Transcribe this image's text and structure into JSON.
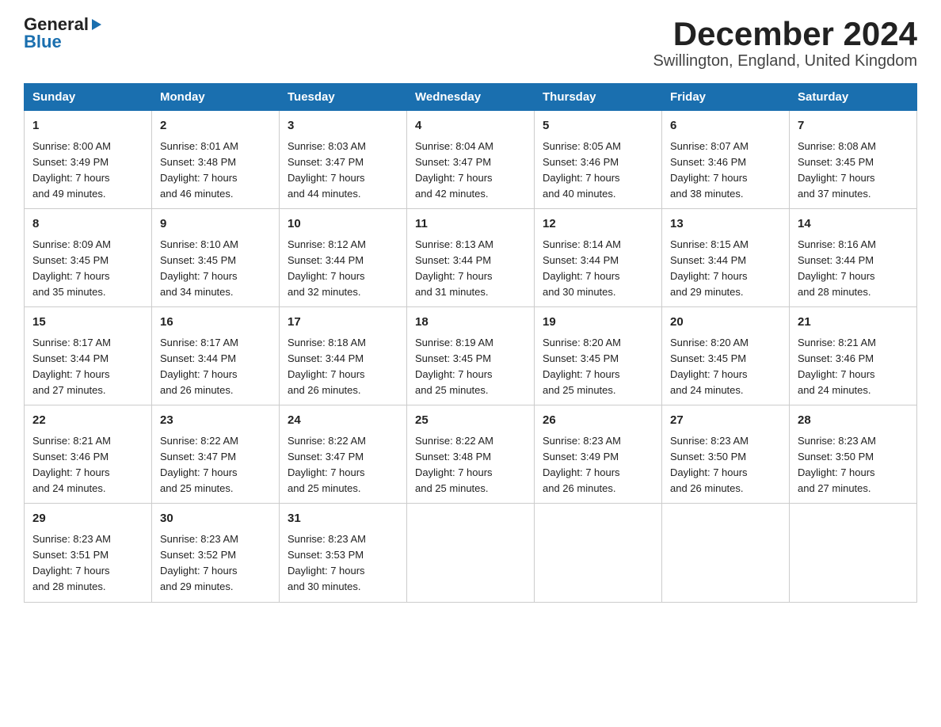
{
  "header": {
    "title": "December 2024",
    "subtitle": "Swillington, England, United Kingdom",
    "logo_general": "General",
    "logo_blue": "Blue"
  },
  "days_of_week": [
    "Sunday",
    "Monday",
    "Tuesday",
    "Wednesday",
    "Thursday",
    "Friday",
    "Saturday"
  ],
  "weeks": [
    [
      {
        "day": "1",
        "sunrise": "8:00 AM",
        "sunset": "3:49 PM",
        "daylight": "7 hours and 49 minutes."
      },
      {
        "day": "2",
        "sunrise": "8:01 AM",
        "sunset": "3:48 PM",
        "daylight": "7 hours and 46 minutes."
      },
      {
        "day": "3",
        "sunrise": "8:03 AM",
        "sunset": "3:47 PM",
        "daylight": "7 hours and 44 minutes."
      },
      {
        "day": "4",
        "sunrise": "8:04 AM",
        "sunset": "3:47 PM",
        "daylight": "7 hours and 42 minutes."
      },
      {
        "day": "5",
        "sunrise": "8:05 AM",
        "sunset": "3:46 PM",
        "daylight": "7 hours and 40 minutes."
      },
      {
        "day": "6",
        "sunrise": "8:07 AM",
        "sunset": "3:46 PM",
        "daylight": "7 hours and 38 minutes."
      },
      {
        "day": "7",
        "sunrise": "8:08 AM",
        "sunset": "3:45 PM",
        "daylight": "7 hours and 37 minutes."
      }
    ],
    [
      {
        "day": "8",
        "sunrise": "8:09 AM",
        "sunset": "3:45 PM",
        "daylight": "7 hours and 35 minutes."
      },
      {
        "day": "9",
        "sunrise": "8:10 AM",
        "sunset": "3:45 PM",
        "daylight": "7 hours and 34 minutes."
      },
      {
        "day": "10",
        "sunrise": "8:12 AM",
        "sunset": "3:44 PM",
        "daylight": "7 hours and 32 minutes."
      },
      {
        "day": "11",
        "sunrise": "8:13 AM",
        "sunset": "3:44 PM",
        "daylight": "7 hours and 31 minutes."
      },
      {
        "day": "12",
        "sunrise": "8:14 AM",
        "sunset": "3:44 PM",
        "daylight": "7 hours and 30 minutes."
      },
      {
        "day": "13",
        "sunrise": "8:15 AM",
        "sunset": "3:44 PM",
        "daylight": "7 hours and 29 minutes."
      },
      {
        "day": "14",
        "sunrise": "8:16 AM",
        "sunset": "3:44 PM",
        "daylight": "7 hours and 28 minutes."
      }
    ],
    [
      {
        "day": "15",
        "sunrise": "8:17 AM",
        "sunset": "3:44 PM",
        "daylight": "7 hours and 27 minutes."
      },
      {
        "day": "16",
        "sunrise": "8:17 AM",
        "sunset": "3:44 PM",
        "daylight": "7 hours and 26 minutes."
      },
      {
        "day": "17",
        "sunrise": "8:18 AM",
        "sunset": "3:44 PM",
        "daylight": "7 hours and 26 minutes."
      },
      {
        "day": "18",
        "sunrise": "8:19 AM",
        "sunset": "3:45 PM",
        "daylight": "7 hours and 25 minutes."
      },
      {
        "day": "19",
        "sunrise": "8:20 AM",
        "sunset": "3:45 PM",
        "daylight": "7 hours and 25 minutes."
      },
      {
        "day": "20",
        "sunrise": "8:20 AM",
        "sunset": "3:45 PM",
        "daylight": "7 hours and 24 minutes."
      },
      {
        "day": "21",
        "sunrise": "8:21 AM",
        "sunset": "3:46 PM",
        "daylight": "7 hours and 24 minutes."
      }
    ],
    [
      {
        "day": "22",
        "sunrise": "8:21 AM",
        "sunset": "3:46 PM",
        "daylight": "7 hours and 24 minutes."
      },
      {
        "day": "23",
        "sunrise": "8:22 AM",
        "sunset": "3:47 PM",
        "daylight": "7 hours and 25 minutes."
      },
      {
        "day": "24",
        "sunrise": "8:22 AM",
        "sunset": "3:47 PM",
        "daylight": "7 hours and 25 minutes."
      },
      {
        "day": "25",
        "sunrise": "8:22 AM",
        "sunset": "3:48 PM",
        "daylight": "7 hours and 25 minutes."
      },
      {
        "day": "26",
        "sunrise": "8:23 AM",
        "sunset": "3:49 PM",
        "daylight": "7 hours and 26 minutes."
      },
      {
        "day": "27",
        "sunrise": "8:23 AM",
        "sunset": "3:50 PM",
        "daylight": "7 hours and 26 minutes."
      },
      {
        "day": "28",
        "sunrise": "8:23 AM",
        "sunset": "3:50 PM",
        "daylight": "7 hours and 27 minutes."
      }
    ],
    [
      {
        "day": "29",
        "sunrise": "8:23 AM",
        "sunset": "3:51 PM",
        "daylight": "7 hours and 28 minutes."
      },
      {
        "day": "30",
        "sunrise": "8:23 AM",
        "sunset": "3:52 PM",
        "daylight": "7 hours and 29 minutes."
      },
      {
        "day": "31",
        "sunrise": "8:23 AM",
        "sunset": "3:53 PM",
        "daylight": "7 hours and 30 minutes."
      },
      null,
      null,
      null,
      null
    ]
  ],
  "labels": {
    "sunrise": "Sunrise:",
    "sunset": "Sunset:",
    "daylight": "Daylight:"
  }
}
